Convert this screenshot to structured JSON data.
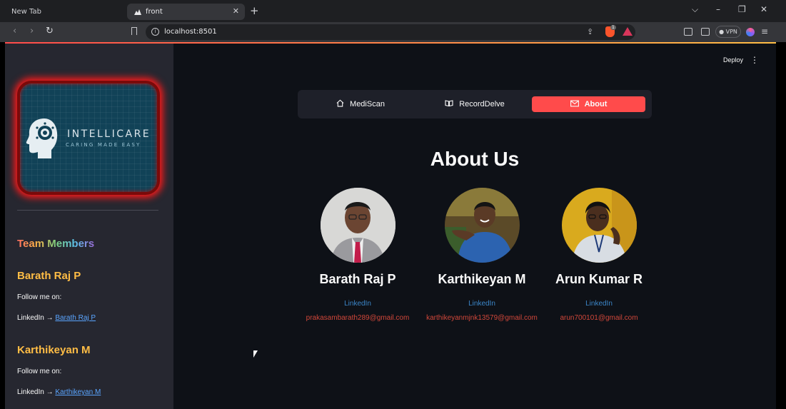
{
  "browser": {
    "tabs": [
      {
        "label": "New Tab"
      },
      {
        "label": "front"
      }
    ],
    "url": "localhost:8501",
    "vpn_label": "VPN",
    "brave_badge": "1"
  },
  "app": {
    "deploy_label": "Deploy",
    "nav": [
      {
        "label": "MediScan",
        "icon": "home-icon"
      },
      {
        "label": "RecordDelve",
        "icon": "book-icon"
      },
      {
        "label": "About",
        "icon": "envelope-icon"
      }
    ],
    "about_title": "About Us",
    "members": [
      {
        "name": "Barath Raj P",
        "linkedin": "LinkedIn",
        "email": "prakasambarath289@gmail.com"
      },
      {
        "name": "Karthikeyan M",
        "linkedin": "LinkedIn",
        "email": "karthikeyanmjnk13579@gmail.com"
      },
      {
        "name": "Arun Kumar R",
        "linkedin": "LinkedIn",
        "email": "arun700101@gmail.com"
      }
    ]
  },
  "sidebar": {
    "logo_name": "INTELLICARE",
    "logo_tagline": "CARING MADE EASY",
    "team_title": "Team Members",
    "members": [
      {
        "name": "Barath Raj P",
        "follow": "Follow me on:",
        "li_prefix": "LinkedIn → ",
        "li_link": "Barath Raj P"
      },
      {
        "name": "Karthikeyan M",
        "follow": "Follow me on:",
        "li_prefix": "LinkedIn → ",
        "li_link": "Karthikeyan M"
      }
    ]
  }
}
